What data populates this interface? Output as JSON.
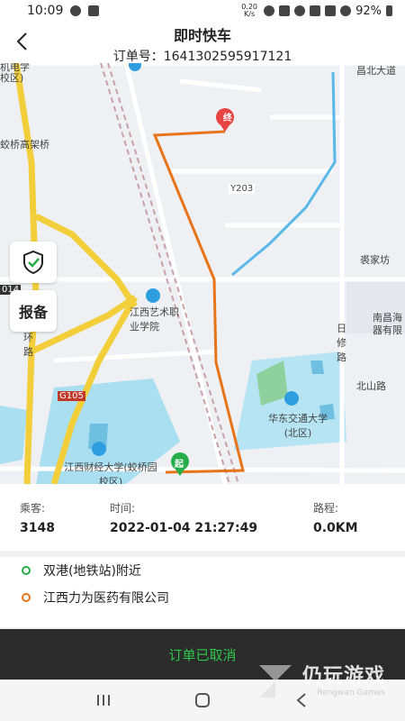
{
  "status": {
    "time": "10:09",
    "speed": "0.20 K/s",
    "battery": "92%"
  },
  "header": {
    "title": "即时快车",
    "order": "订单号：1641302595917121"
  },
  "map": {
    "labels": [
      "昌北大道",
      "蛟桥高架桥",
      "Y203",
      "裘家坊",
      "江西艺术职业学院",
      "日修路",
      "南昌海",
      "器有限",
      "北山路",
      "华东交通大学(北区)",
      "G105",
      "江西财经大学(蛟桥园校区)",
      "014",
      "环路",
      "校区)",
      "机电学"
    ],
    "start_marker": "起",
    "end_marker": "终"
  },
  "side": {
    "report_label": "报备"
  },
  "info": {
    "passenger_label": "乘客:",
    "passenger_value": "3148",
    "time_label": "时间:",
    "time_value": "2022-01-04 21:27:49",
    "distance_label": "路程:",
    "distance_value": "0.0KM"
  },
  "stops": {
    "start": "双港(地铁站)附近",
    "end": "江西力为医药有限公司"
  },
  "footer": {
    "status": "订单已取消"
  },
  "watermark": {
    "cn": "仍玩游戏",
    "en": "Rengwan Games"
  },
  "colors": {
    "route": "#e8741a",
    "accent": "#2ec84a",
    "start": "#27ae4b"
  }
}
